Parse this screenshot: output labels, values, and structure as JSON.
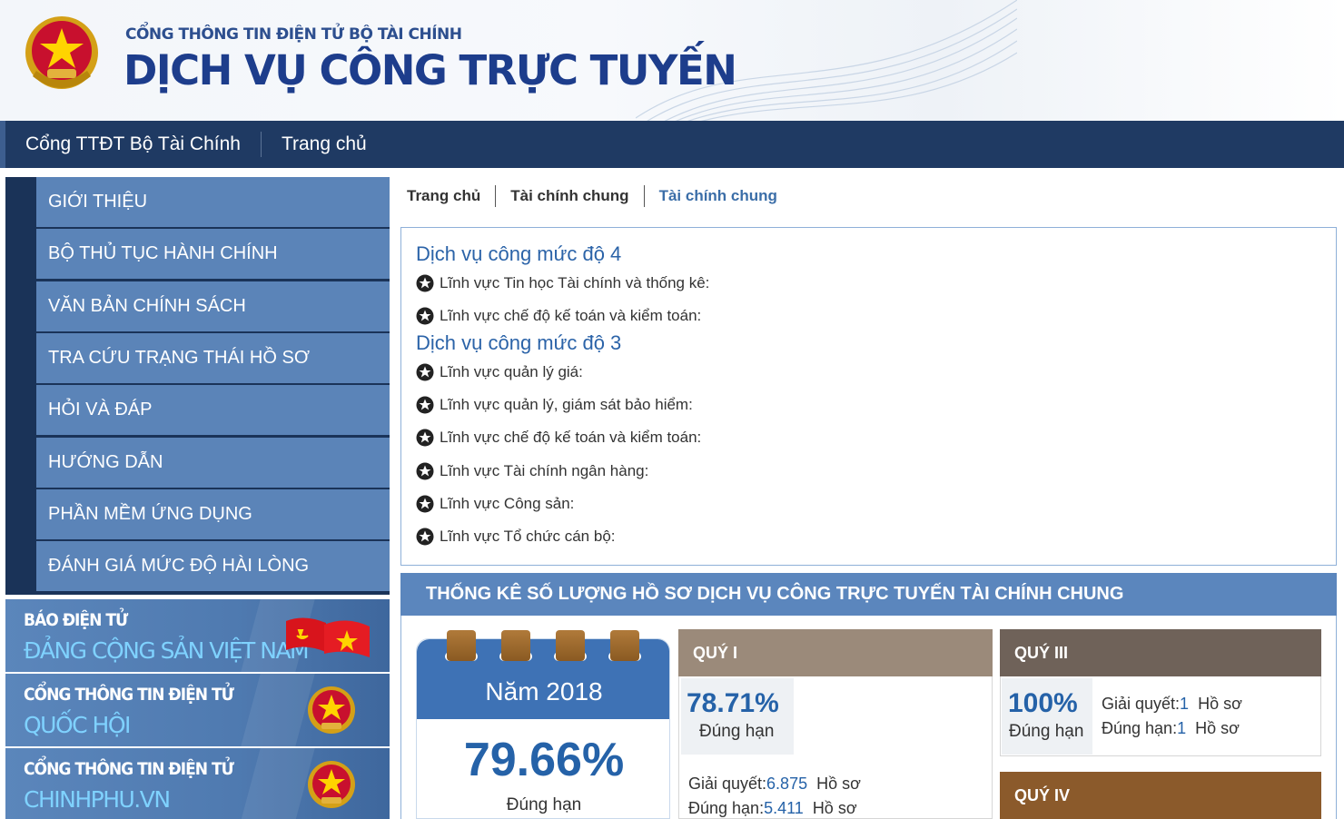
{
  "header": {
    "portal_subtitle": "CỔNG THÔNG TIN ĐIỆN TỬ BỘ TÀI CHÍNH",
    "portal_title": "DỊCH VỤ CÔNG TRỰC TUYẾN"
  },
  "topnav": {
    "items": [
      {
        "label": "Cổng TTĐT Bộ Tài Chính"
      },
      {
        "label": "Trang chủ"
      }
    ]
  },
  "sidebar": {
    "items": [
      {
        "label": "GIỚI THIỆU"
      },
      {
        "label": "BỘ THỦ TỤC HÀNH CHÍNH"
      },
      {
        "label": "VĂN BẢN CHÍNH SÁCH"
      },
      {
        "label": "TRA CỨU TRẠNG THÁI HỒ SƠ"
      },
      {
        "label": "HỎI VÀ ĐÁP"
      },
      {
        "label": "HƯỚNG DẪN"
      },
      {
        "label": "PHẦN MỀM ỨNG DỤNG"
      },
      {
        "label": "ĐÁNH GIÁ MỨC ĐỘ HÀI LÒNG"
      }
    ]
  },
  "promos": [
    {
      "line1": "BÁO ĐIỆN TỬ",
      "line2": "ĐẢNG CỘNG SẢN VIỆT NAM"
    },
    {
      "line1": "CỔNG THÔNG TIN ĐIỆN TỬ",
      "line2": "QUỐC HỘI"
    },
    {
      "line1": "CỔNG THÔNG TIN ĐIỆN TỬ",
      "line2": "CHINHPHU.VN"
    }
  ],
  "breadcrumb": [
    "Trang chủ",
    "Tài chính chung",
    "Tài chính chung"
  ],
  "services": {
    "level4_title": "Dịch vụ công mức độ 4",
    "level4_items": [
      "Lĩnh vực Tin học Tài chính và thống kê:",
      "Lĩnh vực chế độ kế toán và kiểm toán:"
    ],
    "level3_title": "Dịch vụ công mức độ 3",
    "level3_items": [
      "Lĩnh vực quản lý giá:",
      "Lĩnh vực quản lý, giám sát bảo hiểm:",
      "Lĩnh vực chế độ kế toán và kiểm toán:",
      "Lĩnh vực Tài chính ngân hàng:",
      "Lĩnh vực Công sản:",
      "Lĩnh vực Tổ chức cán bộ:"
    ]
  },
  "stats": {
    "title": "THỐNG KÊ SỐ LƯỢNG HỒ SƠ DỊCH VỤ CÔNG TRỰC TUYẾN TÀI CHÍNH CHUNG",
    "year": {
      "label": "Năm 2018",
      "pct": "79.66%",
      "pct_label": "Đúng hạn"
    },
    "q1": {
      "title": "QUÝ I",
      "pct": "78.71%",
      "pct_label": "Đúng hạn",
      "resolved_label": "Giải quyết:",
      "resolved": "6.875",
      "resolved_unit": "Hồ sơ",
      "ontime_label": "Đúng hạn:",
      "ontime": "5.411",
      "ontime_unit": "Hồ sơ"
    },
    "q3": {
      "title": "QUÝ III",
      "pct": "100%",
      "pct_label": "Đúng hạn",
      "resolved_label": "Giải quyết:",
      "resolved": "1",
      "resolved_unit": "Hồ sơ",
      "ontime_label": "Đúng hạn:",
      "ontime": "1",
      "ontime_unit": "Hồ sơ"
    },
    "q4": {
      "title": "QUÝ IV"
    },
    "colors": {
      "q1": "#9b8a7a",
      "q3": "#6f6259",
      "q4": "#8b5a2b"
    }
  }
}
